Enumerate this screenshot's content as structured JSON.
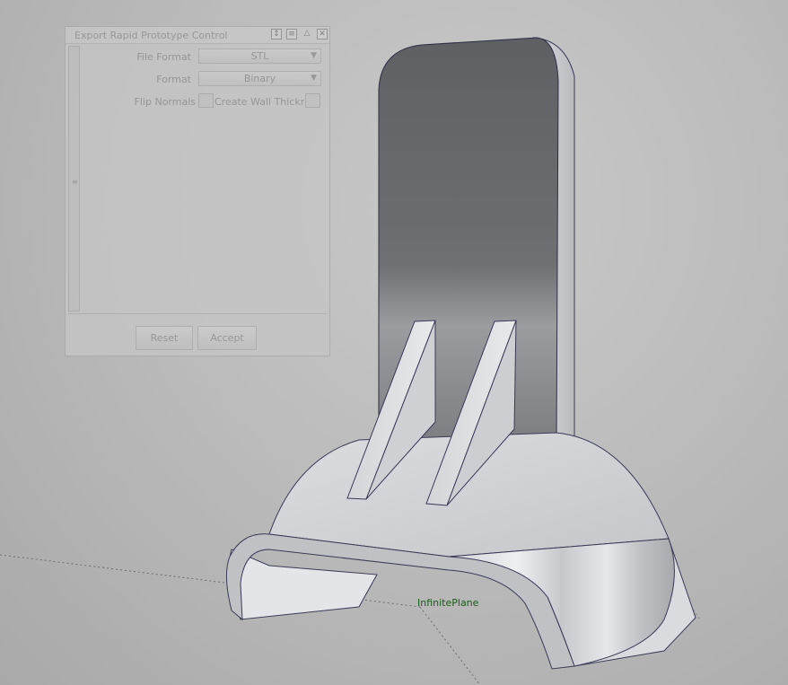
{
  "panel": {
    "title": "Export Rapid Prototype Control",
    "file_format_label": "File Format",
    "file_format_value": "STL",
    "format_label": "Format",
    "format_value": "Binary",
    "flip_normals_label": "Flip Normals",
    "create_wall_label": "Create Wall Thicknes",
    "reset_label": "Reset",
    "accept_label": "Accept"
  },
  "viewport": {
    "plane_label": "InfinitePlane"
  }
}
